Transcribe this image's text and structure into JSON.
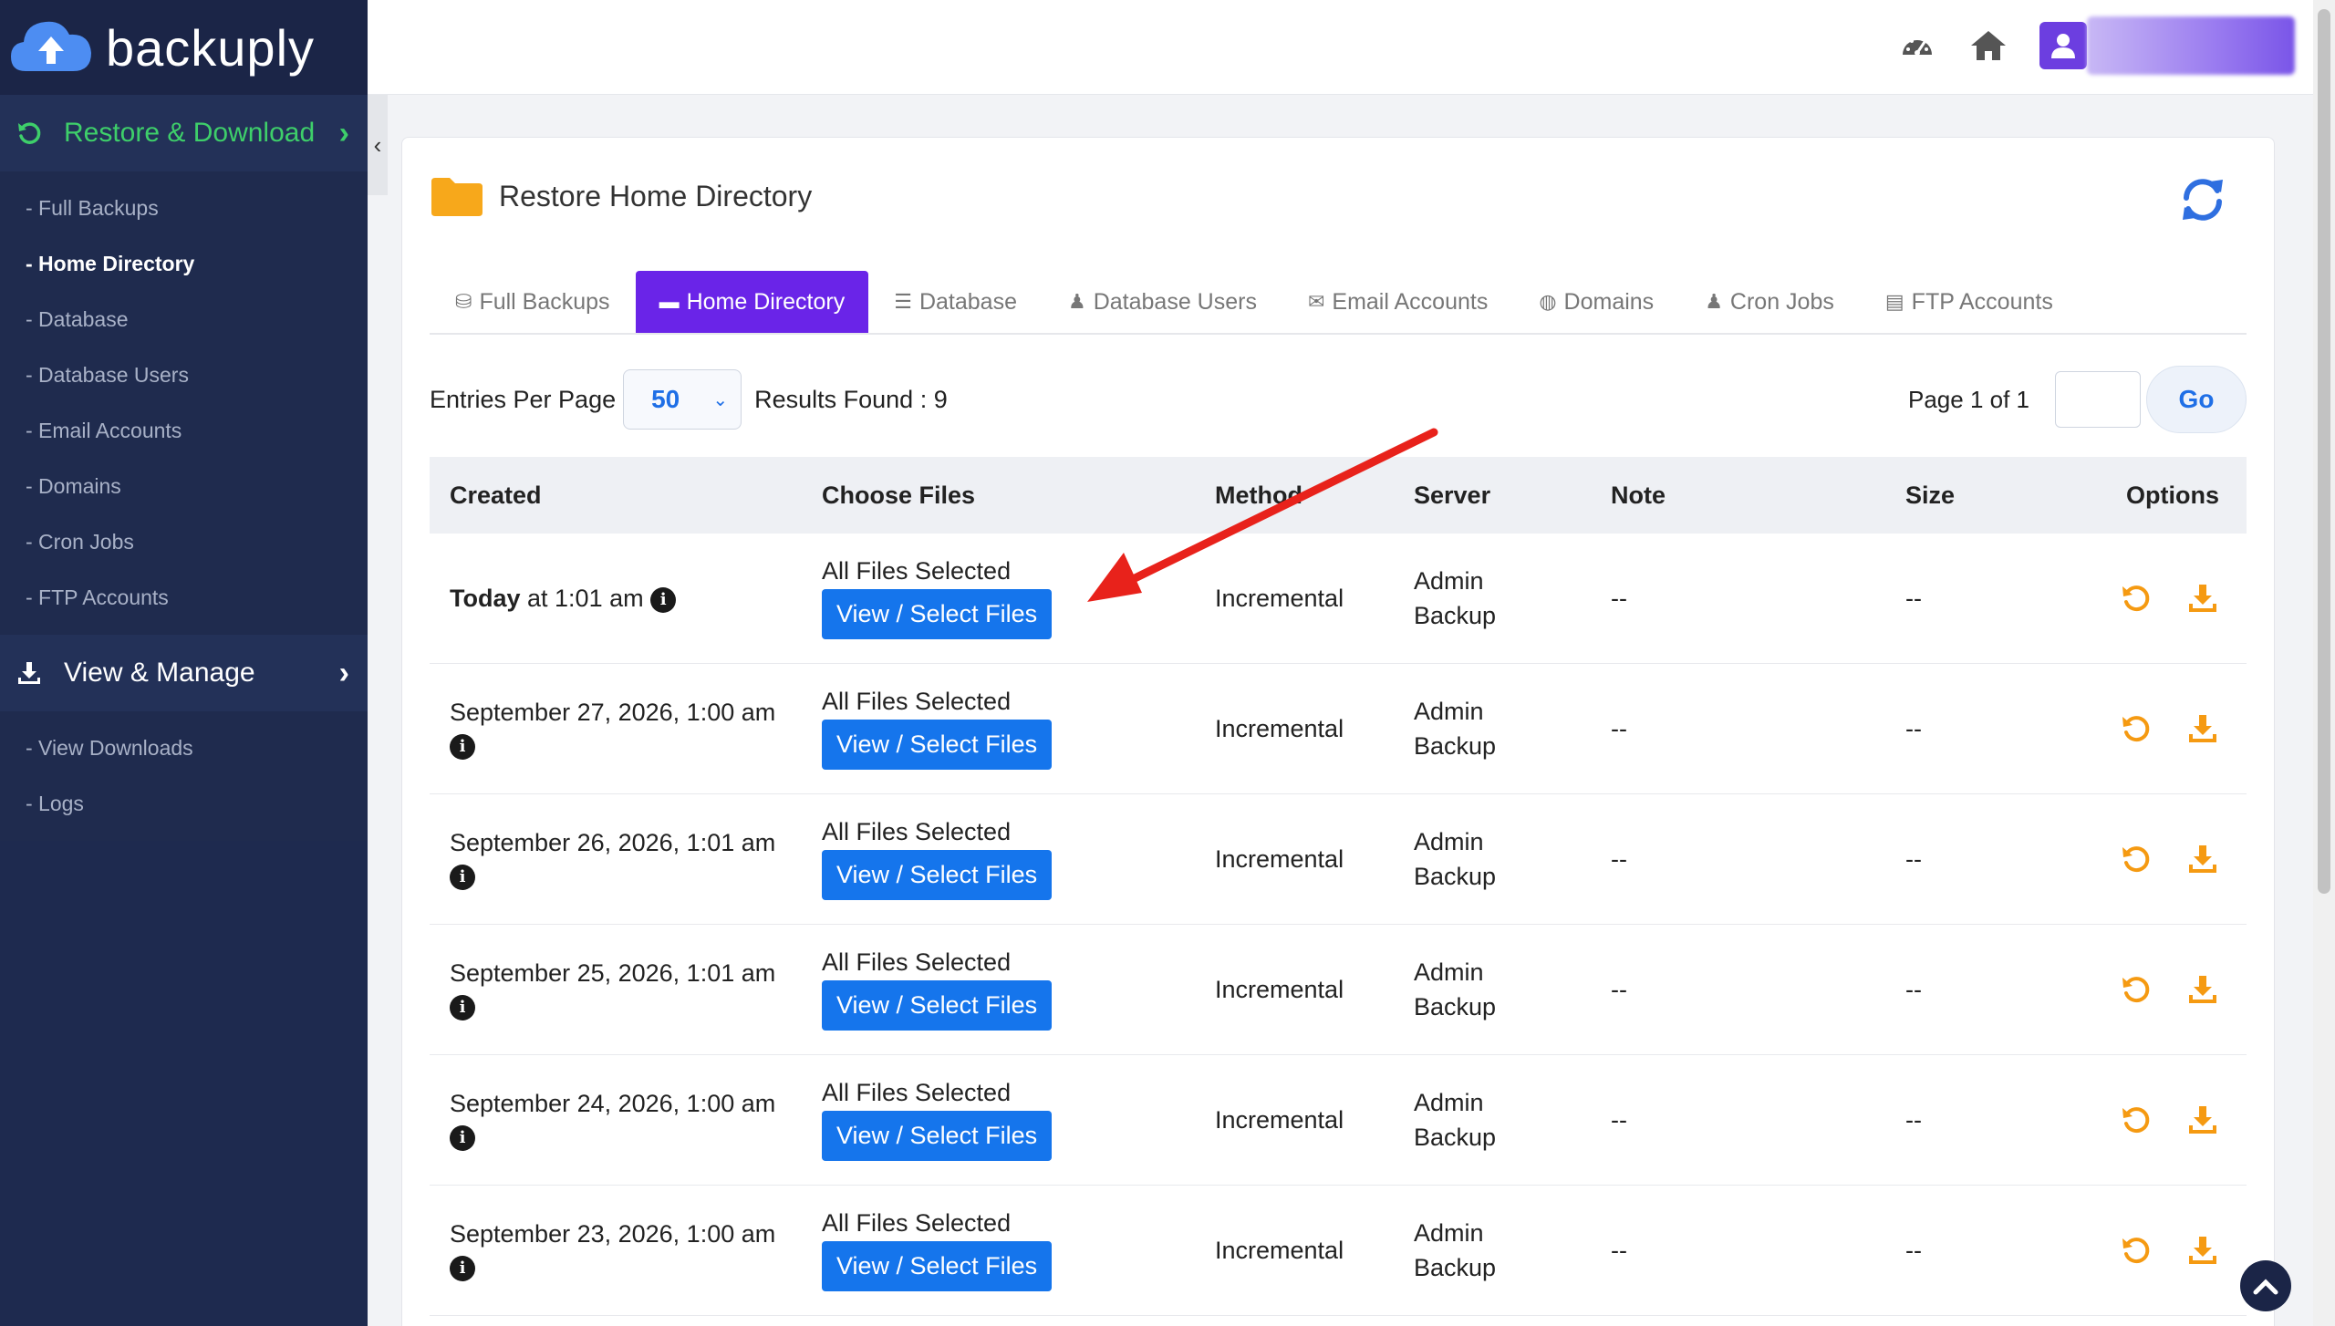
{
  "brand": {
    "name": "backuply"
  },
  "sidebar": {
    "restore_section": {
      "label": "Restore & Download"
    },
    "restore_items": [
      {
        "label": "- Full Backups",
        "active": false
      },
      {
        "label": "- Home Directory",
        "active": true
      },
      {
        "label": "- Database",
        "active": false
      },
      {
        "label": "- Database Users",
        "active": false
      },
      {
        "label": "- Email Accounts",
        "active": false
      },
      {
        "label": "- Domains",
        "active": false
      },
      {
        "label": "- Cron Jobs",
        "active": false
      },
      {
        "label": "- FTP Accounts",
        "active": false
      }
    ],
    "view_section": {
      "label": "View & Manage"
    },
    "view_items": [
      {
        "label": "- View Downloads"
      },
      {
        "label": "- Logs"
      }
    ]
  },
  "topbar": {
    "icons": [
      "dashboard-icon",
      "home-icon",
      "user-icon"
    ]
  },
  "card": {
    "title": "Restore Home Directory"
  },
  "tabs": [
    {
      "label": "Full Backups",
      "icon": "cubes-icon",
      "glyph": "⛁",
      "active": false
    },
    {
      "label": "Home Directory",
      "icon": "folder-icon",
      "glyph": "▬",
      "active": true
    },
    {
      "label": "Database",
      "icon": "database-icon",
      "glyph": "☰",
      "active": false
    },
    {
      "label": "Database Users",
      "icon": "user-icon",
      "glyph": "♟",
      "active": false
    },
    {
      "label": "Email Accounts",
      "icon": "envelope-icon",
      "glyph": "✉",
      "active": false
    },
    {
      "label": "Domains",
      "icon": "globe-icon",
      "glyph": "◍",
      "active": false
    },
    {
      "label": "Cron Jobs",
      "icon": "user-clock-icon",
      "glyph": "♟",
      "active": false
    },
    {
      "label": "FTP Accounts",
      "icon": "file-icon",
      "glyph": "▤",
      "active": false
    }
  ],
  "controls": {
    "entries_label": "Entries Per Page",
    "entries_value": "50",
    "results_label": "Results Found : 9",
    "page_label": "Page 1 of 1",
    "page_input_value": "",
    "go_label": "Go"
  },
  "table": {
    "headers": {
      "created": "Created",
      "files": "Choose Files",
      "method": "Method",
      "server": "Server",
      "note": "Note",
      "size": "Size",
      "options": "Options"
    },
    "rows": [
      {
        "created_bold": "Today",
        "created_rest": " at 1:01 am",
        "files_status": "All Files Selected",
        "button": "View / Select Files",
        "method": "Incremental",
        "server_line1": "Admin",
        "server_line2": "Backup",
        "note": "--",
        "size": "--"
      },
      {
        "created_bold": "",
        "created_rest": "September 27, 2026, 1:00 am",
        "files_status": "All Files Selected",
        "button": "View / Select Files",
        "method": "Incremental",
        "server_line1": "Admin",
        "server_line2": "Backup",
        "note": "--",
        "size": "--"
      },
      {
        "created_bold": "",
        "created_rest": "September 26, 2026, 1:01 am",
        "files_status": "All Files Selected",
        "button": "View / Select Files",
        "method": "Incremental",
        "server_line1": "Admin",
        "server_line2": "Backup",
        "note": "--",
        "size": "--"
      },
      {
        "created_bold": "",
        "created_rest": "September 25, 2026, 1:01 am",
        "files_status": "All Files Selected",
        "button": "View / Select Files",
        "method": "Incremental",
        "server_line1": "Admin",
        "server_line2": "Backup",
        "note": "--",
        "size": "--"
      },
      {
        "created_bold": "",
        "created_rest": "September 24, 2026, 1:00 am",
        "files_status": "All Files Selected",
        "button": "View / Select Files",
        "method": "Incremental",
        "server_line1": "Admin",
        "server_line2": "Backup",
        "note": "--",
        "size": "--"
      },
      {
        "created_bold": "",
        "created_rest": "September 23, 2026, 1:00 am",
        "files_status": "All Files Selected",
        "button": "View / Select Files",
        "method": "Incremental",
        "server_line1": "Admin",
        "server_line2": "Backup",
        "note": "--",
        "size": "--"
      }
    ]
  },
  "colors": {
    "sidebar_bg": "#1e2a4f",
    "restore_accent": "#3ecf6a",
    "active_tab": "#6a24e8",
    "primary_button": "#1575ec",
    "option_icons": "#f59a12",
    "annotation_arrow": "#e8221b"
  }
}
